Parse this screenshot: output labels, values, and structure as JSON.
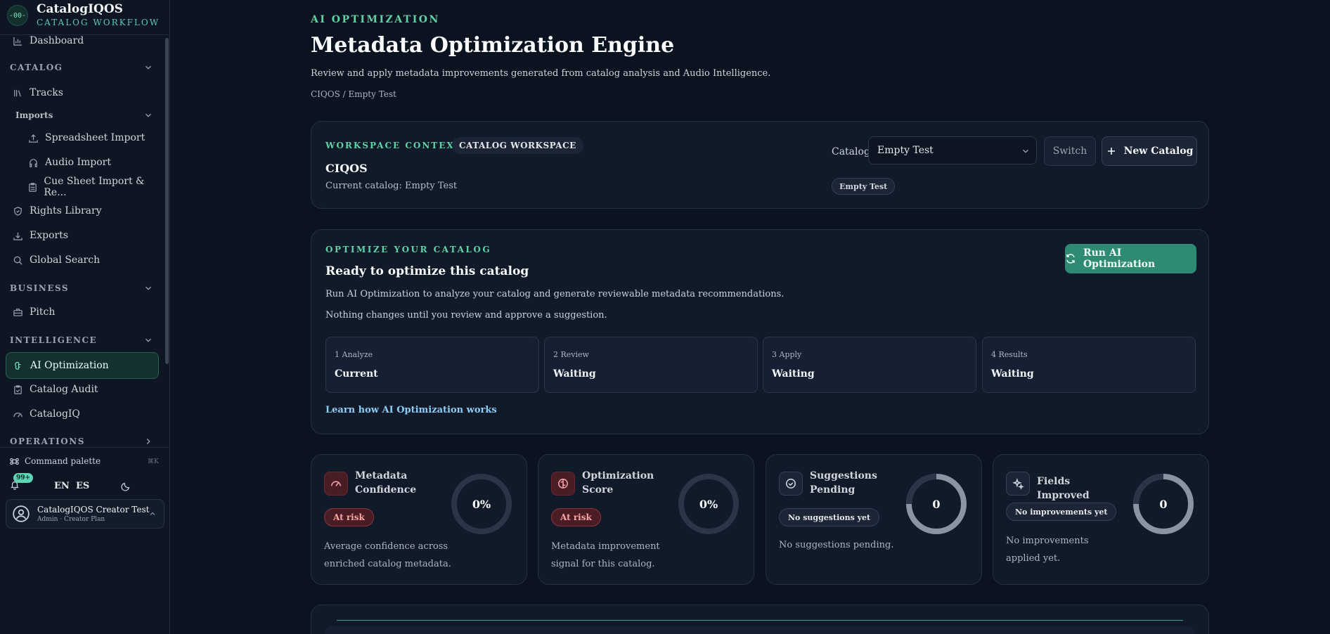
{
  "brand": {
    "logo_text": "-00-",
    "title": "CatalogIQOS",
    "subtitle": "CATALOG WORKFLOW"
  },
  "sidebar": {
    "dashboard": "Dashboard",
    "catalog_section": "CATALOG",
    "tracks": "Tracks",
    "imports_section": "Imports",
    "spreadsheet_import": "Spreadsheet Import",
    "audio_import": "Audio Import",
    "cue_sheet_import": "Cue Sheet Import & Re...",
    "rights_library": "Rights Library",
    "exports": "Exports",
    "global_search": "Global Search",
    "business_section": "BUSINESS",
    "pitch": "Pitch",
    "intelligence_section": "INTELLIGENCE",
    "ai_optimization": "AI Optimization",
    "catalog_audit": "Catalog Audit",
    "catalogiq": "CatalogIQ",
    "operations_section": "OPERATIONS"
  },
  "footer": {
    "command_palette": "Command palette",
    "shortcut": "⌘K",
    "notifications_badge": "99+",
    "lang_en": "EN",
    "lang_es": "ES",
    "user_name": "CatalogIQOS Creator Test",
    "user_plan": "Admin · Creator Plan"
  },
  "header": {
    "eyebrow": "AI OPTIMIZATION",
    "title": "Metadata Optimization Engine",
    "description": "Review and apply metadata improvements generated from catalog analysis and Audio Intelligence.",
    "breadcrumb": "CIQOS / Empty Test"
  },
  "workspace": {
    "eyebrow": "WORKSPACE CONTEXT",
    "badge": "CATALOG WORKSPACE",
    "name": "CIQOS",
    "current": "Current catalog: Empty Test",
    "catalog_label": "Catalog",
    "catalog_value": "Empty Test",
    "switch_label": "Switch",
    "new_catalog_label": "New Catalog",
    "catalog_pill": "Empty Test"
  },
  "optimize": {
    "eyebrow": "OPTIMIZE YOUR CATALOG",
    "title": "Ready to optimize this catalog",
    "line1": "Run AI Optimization to analyze your catalog and generate reviewable metadata recommendations.",
    "line2": "Nothing changes until you review and approve a suggestion.",
    "run_label": "Run AI Optimization",
    "steps": [
      {
        "label": "1 Analyze",
        "value": "Current"
      },
      {
        "label": "2 Review",
        "value": "Waiting"
      },
      {
        "label": "3 Apply",
        "value": "Waiting"
      },
      {
        "label": "4 Results",
        "value": "Waiting"
      }
    ],
    "learn": "Learn how AI Optimization works"
  },
  "metrics": [
    {
      "title": "Metadata Confidence",
      "value": "0%",
      "pill": "At risk",
      "desc": "Average confidence across enriched catalog metadata.",
      "icon": "gauge-icon",
      "fraction": 0
    },
    {
      "title": "Optimization Score",
      "value": "0%",
      "pill": "At risk",
      "desc": "Metadata improvement signal for this catalog.",
      "icon": "brain-icon",
      "fraction": 0
    },
    {
      "title": "Suggestions Pending",
      "value": "0",
      "pill": "No suggestions yet",
      "desc": "No suggestions pending.",
      "icon": "check-circle-icon",
      "fraction": 0
    },
    {
      "title": "Fields Improved",
      "value": "0",
      "pill": "No improvements yet",
      "desc": "No improvements applied yet.",
      "icon": "sparkles-icon",
      "fraction": 0
    }
  ],
  "colors": {
    "accent": "#5fd3a5",
    "run_button": "#2f8a73",
    "risk": "#fca5a5",
    "background": "#0b1220"
  }
}
